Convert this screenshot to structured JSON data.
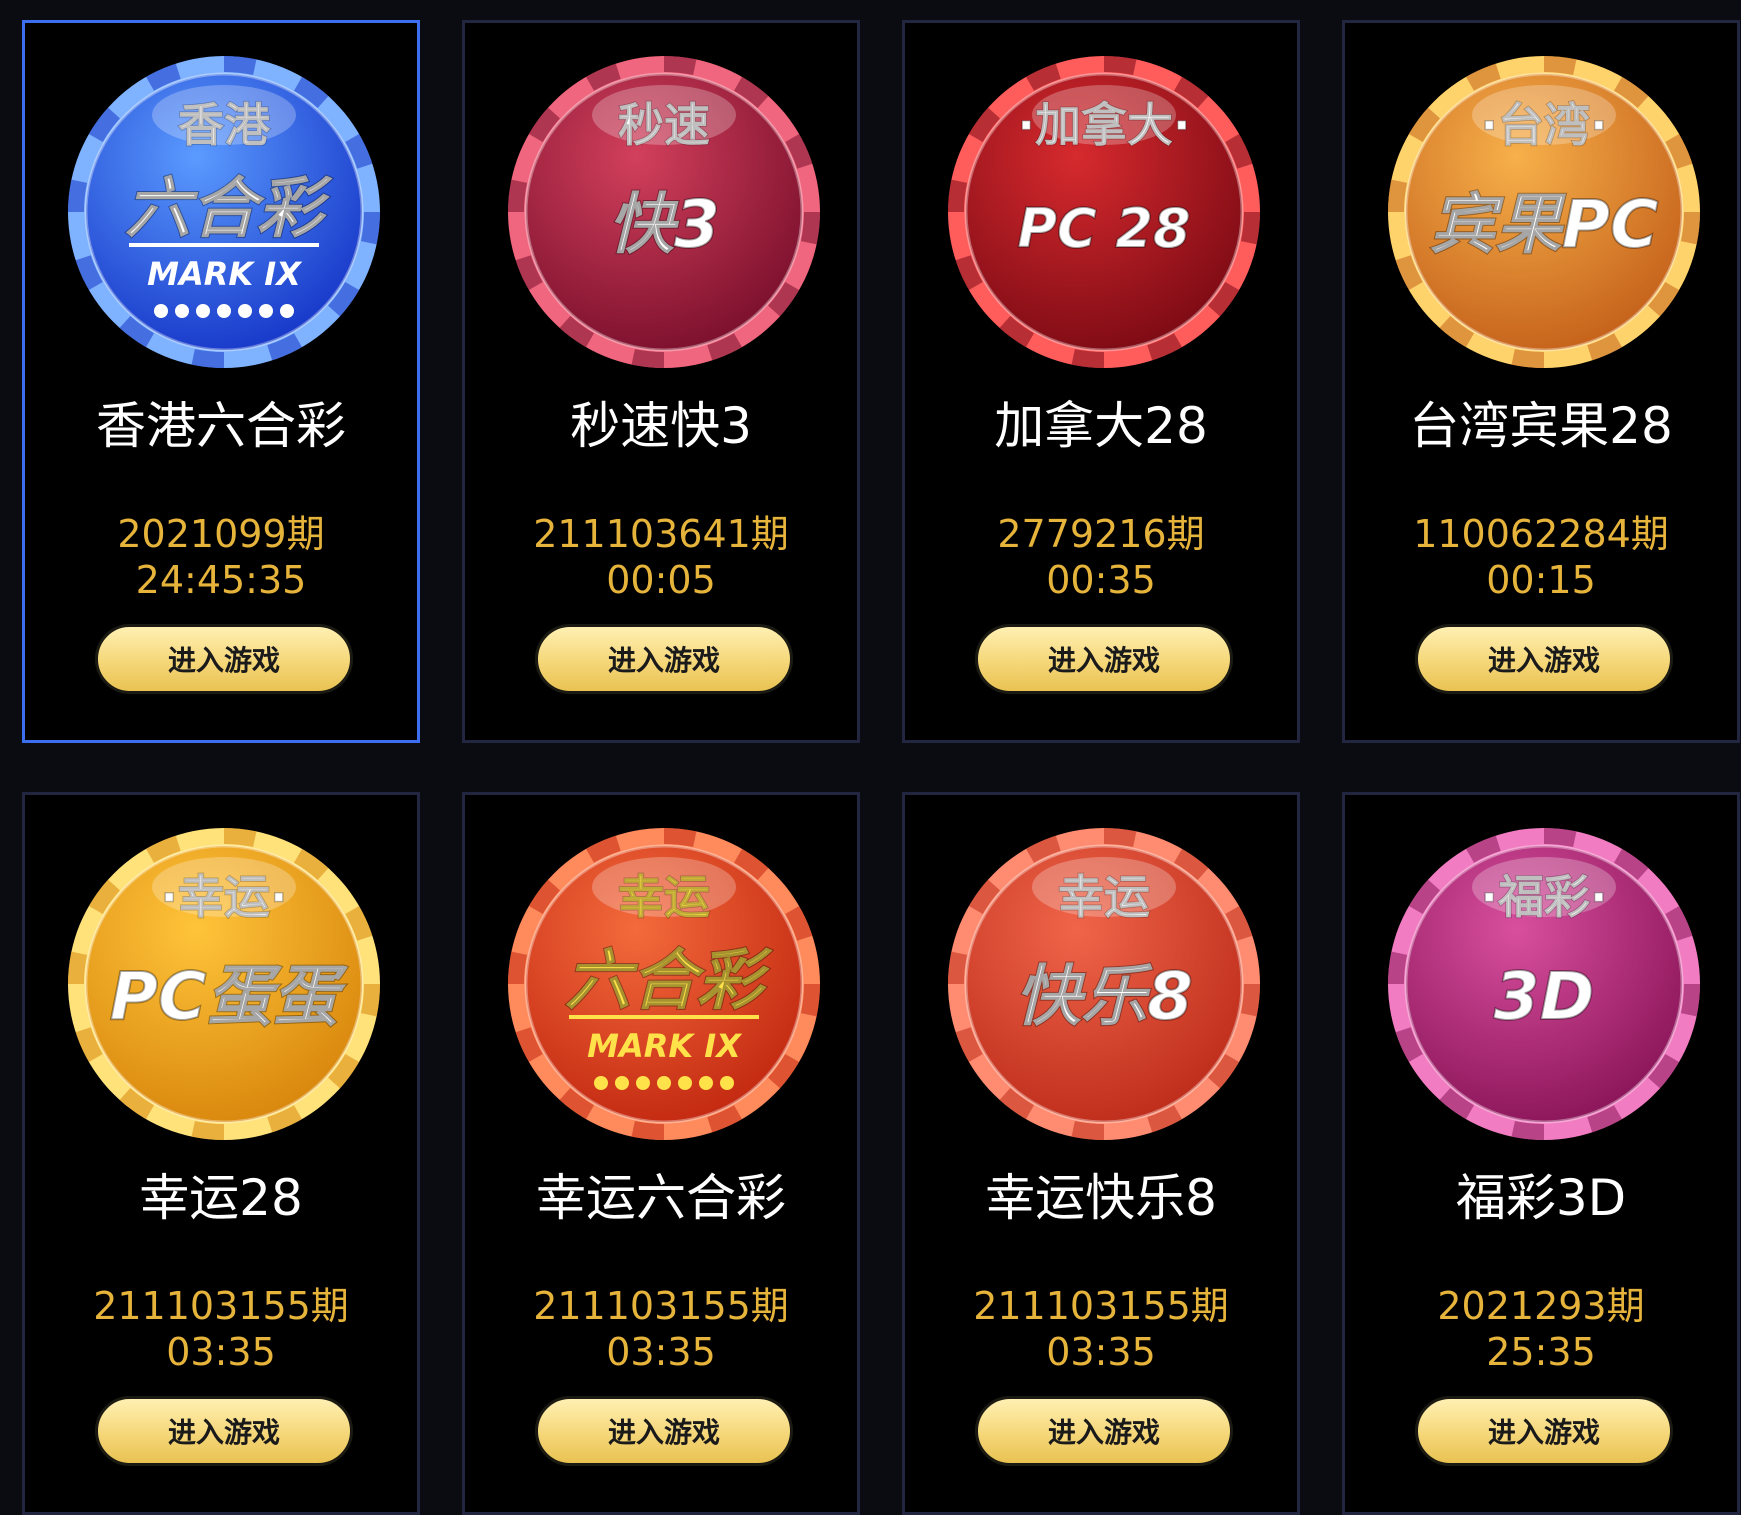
{
  "games": [
    {
      "name": "香港六合彩",
      "issue": "2021099期",
      "countdown": "24:45:35",
      "button": "进入游戏",
      "icon": {
        "name": "hk-mark-six-icon",
        "top": "香港",
        "main": "六合彩",
        "sub": "MARK  IX",
        "color_light": "#5b9bff",
        "color_dark": "#1636c8",
        "rim": "#7fb3ff",
        "text_color": "#ffffff",
        "dots": true
      }
    },
    {
      "name": "秒速快3",
      "issue": "211103641期",
      "countdown": "00:05",
      "button": "进入游戏",
      "icon": {
        "name": "speed-fast3-icon",
        "top": "秒速",
        "main": "快3",
        "sub": "",
        "color_light": "#d2405c",
        "color_dark": "#7a0f2c",
        "rim": "#f0667e",
        "text_color": "#ffffff",
        "dots": false
      }
    },
    {
      "name": "加拿大28",
      "issue": "2779216期",
      "countdown": "00:35",
      "button": "进入游戏",
      "icon": {
        "name": "canada-pc28-icon",
        "top": "·加拿大·",
        "main": "PC 28",
        "sub": "",
        "color_light": "#d62a2e",
        "color_dark": "#7c0a14",
        "rim": "#ff5c5c",
        "text_color": "#ffffff",
        "dots": false
      }
    },
    {
      "name": "台湾宾果28",
      "issue": "110062284期",
      "countdown": "00:15",
      "button": "进入游戏",
      "icon": {
        "name": "taiwan-bingo-pc-icon",
        "top": "·台湾·",
        "main": "宾果PC",
        "sub": "",
        "color_light": "#f7b04a",
        "color_dark": "#c4601a",
        "rim": "#ffd36b",
        "text_color": "#ffffff",
        "dots": false
      }
    },
    {
      "name": "幸运28",
      "issue": "211103155期",
      "countdown": "03:35",
      "button": "进入游戏",
      "icon": {
        "name": "lucky-pc-egg-icon",
        "top": "·幸运·",
        "main": "PC蛋蛋",
        "sub": "",
        "color_light": "#ffc43a",
        "color_dark": "#d8860c",
        "rim": "#ffe27a",
        "text_color": "#ffffff",
        "dots": false
      }
    },
    {
      "name": "幸运六合彩",
      "issue": "211103155期",
      "countdown": "03:35",
      "button": "进入游戏",
      "icon": {
        "name": "lucky-mark-six-icon",
        "top": "幸运",
        "main": "六合彩",
        "sub": "MARK  IX",
        "color_light": "#f46a3c",
        "color_dark": "#c22810",
        "rim": "#ff8a5c",
        "text_color": "#ffe24a",
        "dots": true
      }
    },
    {
      "name": "幸运快乐8",
      "issue": "211103155期",
      "countdown": "03:35",
      "button": "进入游戏",
      "icon": {
        "name": "lucky-happy8-icon",
        "top": "幸运",
        "main": "快乐8",
        "sub": "",
        "color_light": "#f0654a",
        "color_dark": "#bd2c1a",
        "rim": "#ff8c70",
        "text_color": "#ffffff",
        "dots": false
      }
    },
    {
      "name": "福彩3D",
      "issue": "2021293期",
      "countdown": "25:35",
      "button": "进入游戏",
      "icon": {
        "name": "welfare-3d-icon",
        "top": "·福彩·",
        "main": "3D",
        "sub": "",
        "color_light": "#d84f9e",
        "color_dark": "#8a1458",
        "rim": "#f27cc2",
        "text_color": "#ffffff",
        "dots": false
      }
    }
  ]
}
